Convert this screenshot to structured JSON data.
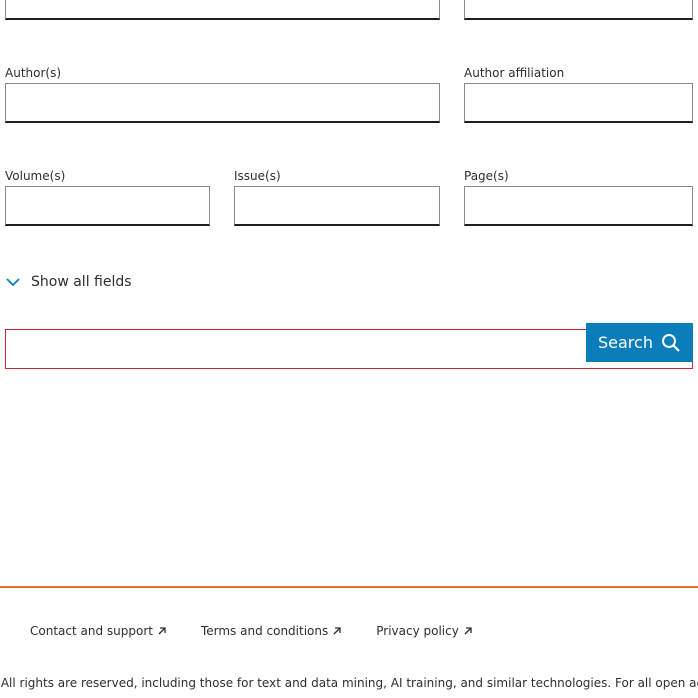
{
  "form": {
    "author_label": "Author(s)",
    "affiliation_label": "Author affiliation",
    "volume_label": "Volume(s)",
    "issue_label": "Issue(s)",
    "page_label": "Page(s)",
    "author_value": "",
    "affiliation_value": "",
    "volume_value": "",
    "issue_value": "",
    "page_value": "",
    "show_all_label": "Show all fields"
  },
  "search": {
    "button_label": "Search",
    "value": ""
  },
  "footer": {
    "links": [
      {
        "label": "Contact and support",
        "icon": "external-arrow-icon"
      },
      {
        "label": "Terms and conditions",
        "icon": "external-arrow-icon"
      },
      {
        "label": "Privacy policy",
        "icon": "external-arrow-icon"
      }
    ],
    "copyright": "rs. All rights are reserved, including those for text and data mining, AI training, and similar technologies. For all open ac"
  },
  "colors": {
    "accent": "#0c7dbb",
    "footer_rule": "#e97420",
    "error_border": "#c3283b"
  }
}
